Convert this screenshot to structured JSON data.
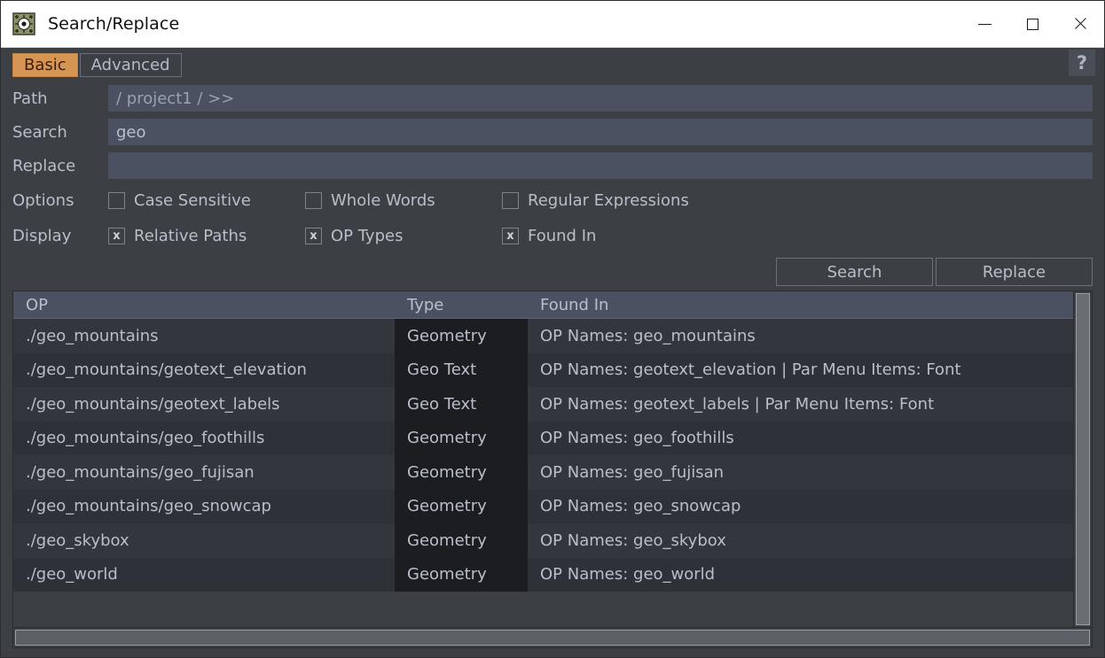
{
  "window": {
    "title": "Search/Replace",
    "icon": "touchdesigner-app-icon",
    "controls": {
      "minimize": "minimize-icon",
      "maximize": "maximize-icon",
      "close": "close-icon"
    }
  },
  "tabs": [
    {
      "label": "Basic",
      "active": true
    },
    {
      "label": "Advanced",
      "active": false
    }
  ],
  "help": {
    "label": "?"
  },
  "colors": {
    "accent_tab": "#d79553",
    "accent_tab_text": "#3a1e0c",
    "window_bg": "#3c3f44",
    "input_bg": "#4b5161",
    "header_bg": "#4b5161",
    "type_cell_bg": "#1b1d21",
    "row_even": "#33363d",
    "row_odd": "#2e3138",
    "text": "#b9bfca",
    "scrollbar_thumb": "#6a6d72"
  },
  "fields": [
    {
      "label": "Path",
      "value": "/ project1 / >>",
      "placeholder": "",
      "is_placeholder": true
    },
    {
      "label": "Search",
      "value": "geo",
      "placeholder": "",
      "is_placeholder": false
    },
    {
      "label": "Replace",
      "value": "",
      "placeholder": "",
      "is_placeholder": false
    }
  ],
  "options": {
    "label": "Options",
    "items": [
      {
        "label": "Case Sensitive",
        "checked": false,
        "mark": ""
      },
      {
        "label": "Whole Words",
        "checked": false,
        "mark": ""
      },
      {
        "label": "Regular Expressions",
        "checked": false,
        "mark": ""
      }
    ]
  },
  "display": {
    "label": "Display",
    "items": [
      {
        "label": "Relative Paths",
        "checked": true,
        "mark": "x"
      },
      {
        "label": "OP Types",
        "checked": true,
        "mark": "x"
      },
      {
        "label": "Found In",
        "checked": true,
        "mark": "x"
      }
    ]
  },
  "actions": [
    {
      "label": "Search"
    },
    {
      "label": "Replace"
    }
  ],
  "results": {
    "columns": [
      "OP",
      "Type",
      "Found In"
    ],
    "rows": [
      {
        "op": "./geo_mountains",
        "type": "Geometry",
        "found_in": "OP Names: geo_mountains"
      },
      {
        "op": "./geo_mountains/geotext_elevation",
        "type": "Geo Text",
        "found_in": "OP Names: geotext_elevation | Par Menu Items: Font"
      },
      {
        "op": "./geo_mountains/geotext_labels",
        "type": "Geo Text",
        "found_in": "OP Names: geotext_labels | Par Menu Items: Font"
      },
      {
        "op": "./geo_mountains/geo_foothills",
        "type": "Geometry",
        "found_in": "OP Names: geo_foothills"
      },
      {
        "op": "./geo_mountains/geo_fujisan",
        "type": "Geometry",
        "found_in": "OP Names: geo_fujisan"
      },
      {
        "op": "./geo_mountains/geo_snowcap",
        "type": "Geometry",
        "found_in": "OP Names: geo_snowcap"
      },
      {
        "op": "./geo_skybox",
        "type": "Geometry",
        "found_in": "OP Names: geo_skybox"
      },
      {
        "op": "./geo_world",
        "type": "Geometry",
        "found_in": "OP Names: geo_world"
      }
    ]
  }
}
